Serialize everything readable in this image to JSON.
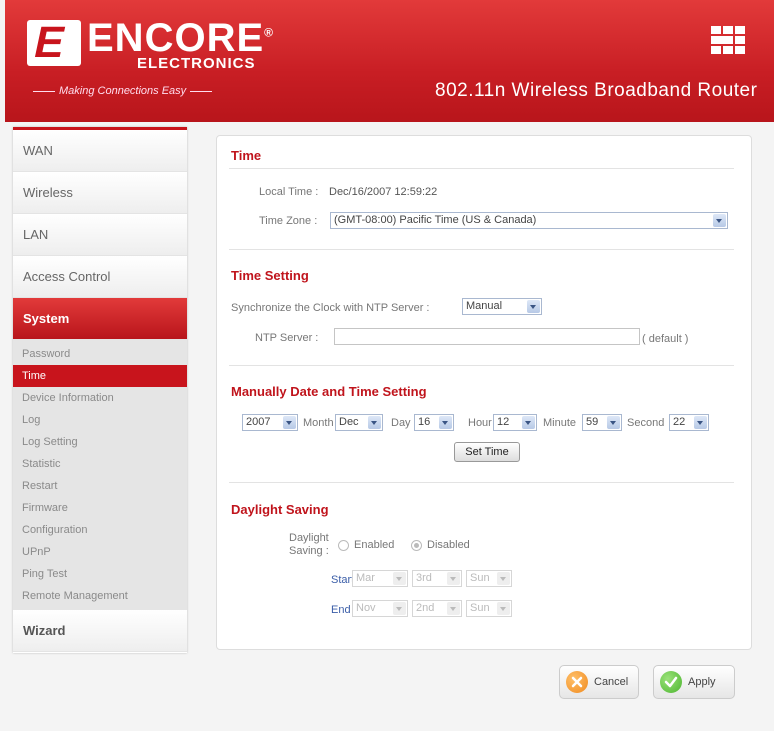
{
  "header": {
    "logo_mark": "E",
    "brand": "ENCORE",
    "brand_sub": "ELECTRONICS",
    "tagline": "Making Connections Easy",
    "product": "802.11n Wireless Broadband Router"
  },
  "sidebar": {
    "main_items": [
      "WAN",
      "Wireless",
      "LAN",
      "Access Control",
      "System",
      "Wizard"
    ],
    "active_main": "System",
    "sub_items": [
      "Password",
      "Time",
      "Device Information",
      "Log",
      "Log Setting",
      "Statistic",
      "Restart",
      "Firmware",
      "Configuration",
      "UPnP",
      "Ping Test",
      "Remote Management"
    ],
    "active_sub": "Time"
  },
  "time": {
    "title": "Time",
    "local_time_label": "Local Time :",
    "local_time_value": "Dec/16/2007 12:59:22",
    "time_zone_label": "Time Zone :",
    "time_zone_value": "(GMT-08:00) Pacific Time (US & Canada)"
  },
  "time_setting": {
    "title": "Time Setting",
    "sync_label": "Synchronize the Clock with NTP Server :",
    "sync_value": "Manual",
    "ntp_label": "NTP Server :",
    "ntp_value": "",
    "default_note": "( default )"
  },
  "manual": {
    "title": "Manually Date and Time Setting",
    "year": "2007",
    "month_label": "Month",
    "month": "Dec",
    "day_label": "Day",
    "day": "16",
    "hour_label": "Hour",
    "hour": "12",
    "minute_label": "Minute",
    "minute": "59",
    "second_label": "Second",
    "second": "22",
    "set_time_button": "Set Time"
  },
  "daylight": {
    "title": "Daylight Saving",
    "label_line1": "Daylight",
    "label_line2": "Saving :",
    "enabled_label": "Enabled",
    "disabled_label": "Disabled",
    "selected": "Disabled",
    "start_label": "Start",
    "start_month": "Mar",
    "start_week": "3rd",
    "start_day": "Sun",
    "end_label": "End",
    "end_month": "Nov",
    "end_week": "2nd",
    "end_day": "Sun"
  },
  "actions": {
    "cancel": "Cancel",
    "apply": "Apply"
  },
  "colors": {
    "brand_red": "#c8141c",
    "cancel_icon": "#f08a1e",
    "apply_icon": "#4cb52f"
  }
}
